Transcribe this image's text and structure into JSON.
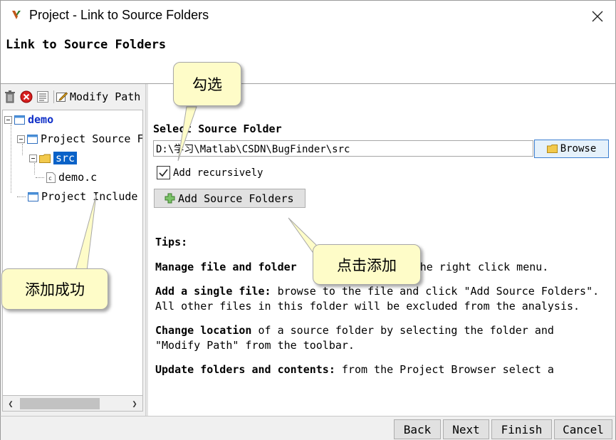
{
  "window": {
    "title": "Project - Link to Source Folders",
    "close_icon": "close-icon"
  },
  "header": {
    "title": "Link to Source Folders"
  },
  "toolbar": {
    "delete_icon": "trash-icon",
    "remove_icon": "remove-circle-icon",
    "list_icon": "list-icon",
    "modify_path_label": "Modify Path"
  },
  "tree": {
    "root": "demo",
    "project_source": "Project Source F",
    "src": "src",
    "demo_c": "demo.c",
    "project_include": "Project Include"
  },
  "source": {
    "select_label": "Select Source Folder",
    "path_value": "D:\\学习\\Matlab\\CSDN\\BugFinder\\src",
    "browse_label": "Browse",
    "recursive_label": "Add recursively",
    "recursive_checked": true,
    "add_label": "Add Source Folders"
  },
  "tips": {
    "heading": "Tips:",
    "manage_bold": "Manage file and folder",
    "manage_rest": "the right click menu.",
    "single_bold": "Add a single file:",
    "single_rest": " browse to the file and click \"Add Source Folders\". All other files in this folder will be excluded from the analysis.",
    "change_bold": "Change location",
    "change_rest": " of a source folder by selecting the folder and \"Modify Path\" from the toolbar.",
    "update_bold": "Update folders and contents:",
    "update_rest": " from the Project Browser select a"
  },
  "footer": {
    "back": "Back",
    "next": "Next",
    "finish": "Finish",
    "cancel": "Cancel"
  },
  "callouts": {
    "check": "勾选",
    "add_success": "添加成功",
    "click_add": "点击添加"
  },
  "colors": {
    "selection": "#0a62c8",
    "root_text": "#1030c8",
    "callout_bg": "#fefcc8",
    "browse_border": "#3c7fd0"
  }
}
